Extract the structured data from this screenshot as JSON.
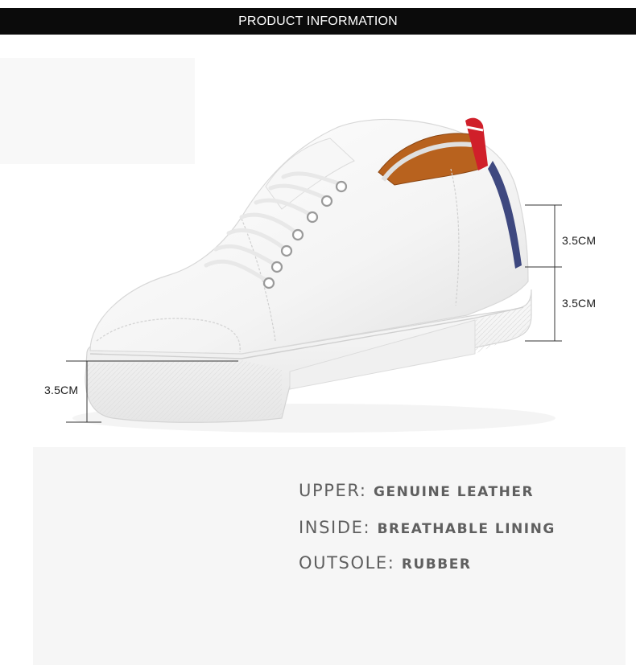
{
  "header": {
    "title": "PRODUCT INFORMATION"
  },
  "product_image": {
    "icon": "white-sneaker-illustration",
    "colors": {
      "upper": "#ffffff",
      "lining": "#b8621e",
      "heel_red": "#d01f2a",
      "heel_navy": "#1f2a6b",
      "outsole": "#f4f4f4"
    }
  },
  "measurements": {
    "heel_upper": "3.5CM",
    "heel_lower": "3.5CM",
    "front_sole": "3.5CM"
  },
  "specs": [
    {
      "key": "UPPER:",
      "value": "GENUINE LEATHER"
    },
    {
      "key": "INSIDE:",
      "value": "BREATHABLE LINING"
    },
    {
      "key": "OUTSOLE:",
      "value": "RUBBER"
    }
  ]
}
